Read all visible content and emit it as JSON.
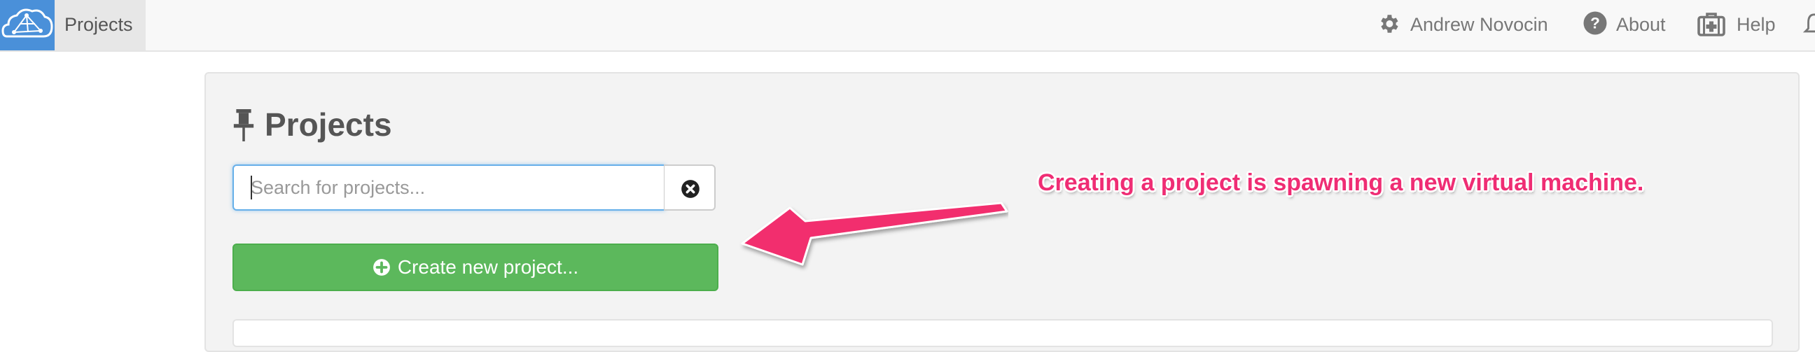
{
  "navbar": {
    "brand_label": "Projects",
    "user_name": "Andrew Novocin",
    "about_label": "About",
    "help_label": "Help",
    "icons": {
      "logo": "cloud-logo-icon",
      "user": "gear-icon",
      "about": "question-circle-icon",
      "help": "medkit-icon",
      "cut_off": "bell-icon"
    }
  },
  "page": {
    "title": "Projects",
    "title_icon": "pin-icon"
  },
  "search": {
    "value": "",
    "placeholder": "Search for projects...",
    "clear_icon": "times-circle-icon"
  },
  "create_button": {
    "label": "Create new project...",
    "icon": "plus-circle-icon"
  },
  "annotation": {
    "text": "Creating a project is spawning a new virtual machine.",
    "color": "#ef2d74"
  },
  "colors": {
    "accent": "#4a90d9",
    "success": "#5cb85c",
    "focus": "#66afe9"
  }
}
